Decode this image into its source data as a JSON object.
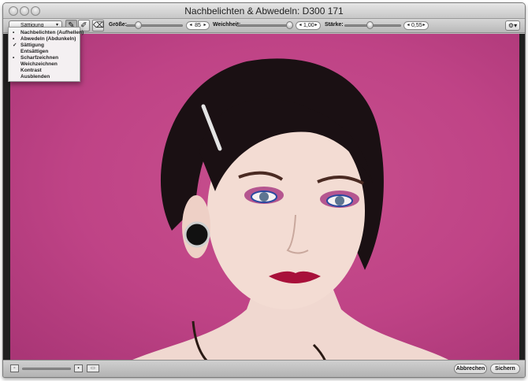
{
  "window": {
    "title": "Nachbelichten & Abwedeln: D300 171"
  },
  "toolbar": {
    "mode_popup": "Sättigung",
    "groesse_label": "Größe:",
    "groesse_value": "85",
    "weichheit_label": "Weichheit:",
    "weichheit_value": "1,00",
    "staerke_label": "Stärke:",
    "staerke_value": "0,55",
    "tools": [
      "brush-icon",
      "feather-brush-icon",
      "eraser-icon"
    ]
  },
  "menu": {
    "items": [
      {
        "mark": "•",
        "label": "Nachbelichten (Aufhellen)"
      },
      {
        "mark": "•",
        "label": "Abwedeln (Abdunkeln)"
      },
      {
        "mark": "✓",
        "label": "Sättigung"
      },
      {
        "mark": "",
        "label": "Entsättigen"
      },
      {
        "mark": "•",
        "label": "Scharfzeichnen"
      },
      {
        "mark": "",
        "label": "Weichzeichnen"
      },
      {
        "mark": "",
        "label": "Kontrast"
      },
      {
        "mark": "",
        "label": "Ausblenden"
      }
    ]
  },
  "footer": {
    "cancel_label": "Abbrechen",
    "save_label": "Sichern"
  },
  "colors": {
    "background": "#bf4386",
    "canvas": "#1f1f1f"
  }
}
